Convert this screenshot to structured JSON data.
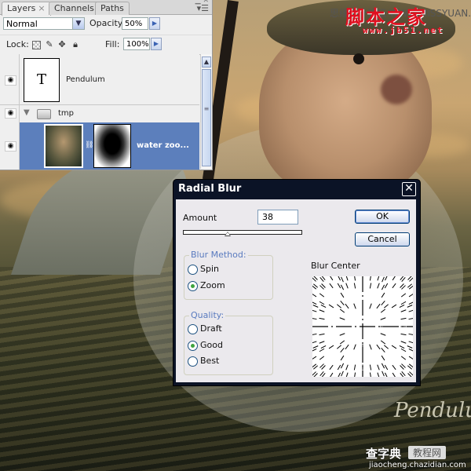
{
  "layers_panel": {
    "tabs": [
      {
        "label": "Layers",
        "active": true,
        "closable": true
      },
      {
        "label": "Channels",
        "active": false
      },
      {
        "label": "Paths",
        "active": false
      }
    ],
    "blend_mode": "Normal",
    "opacity_label": "Opacity:",
    "opacity_value": "50%",
    "lock_label": "Lock:",
    "fill_label": "Fill:",
    "fill_value": "100%",
    "layers": [
      {
        "name": "Pendulum",
        "type": "text",
        "thumb_glyph": "T",
        "visible": true
      },
      {
        "name": "tmp",
        "type": "group",
        "expanded": true,
        "visible": true
      },
      {
        "name": "water zoo...",
        "type": "image-with-mask",
        "visible": true,
        "selected": true
      }
    ]
  },
  "dialog": {
    "title": "Radial Blur",
    "amount_label": "Amount",
    "amount_value": "38",
    "amount_slider_fraction": 0.38,
    "ok_label": "OK",
    "cancel_label": "Cancel",
    "blur_method_title": "Blur Method:",
    "blur_methods": [
      {
        "label": "Spin",
        "checked": false
      },
      {
        "label": "Zoom",
        "checked": true
      }
    ],
    "quality_title": "Quality:",
    "qualities": [
      {
        "label": "Draft",
        "checked": false
      },
      {
        "label": "Good",
        "checked": true
      },
      {
        "label": "Best",
        "checked": false
      }
    ],
    "blur_center_label": "Blur Center"
  },
  "watermarks": {
    "top_gray": "思缘设计论坛 WWW.MISSYUAN.COM",
    "top_red": "脚本之家",
    "top_url": "www.jb51.net",
    "signature": "Pendulum",
    "bottom_brand": "查字典",
    "bottom_tag": "教程网",
    "bottom_url": "jiaocheng.chazidian.com"
  },
  "colors": {
    "selection": "#5c7fbc",
    "dialog_title_bar": "#0b1326",
    "group_title": "#5a7bbf",
    "radio_dot": "#3fa33f",
    "watermark_red": "#e01020"
  }
}
